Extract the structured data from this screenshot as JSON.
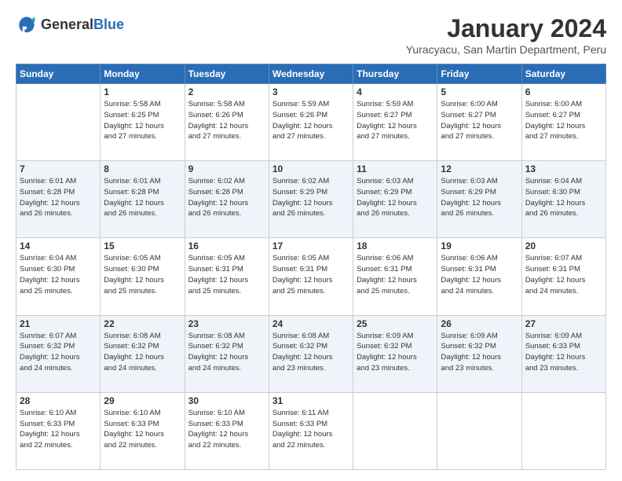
{
  "header": {
    "logo_general": "General",
    "logo_blue": "Blue",
    "title": "January 2024",
    "location": "Yuracyacu, San Martin Department, Peru"
  },
  "weekdays": [
    "Sunday",
    "Monday",
    "Tuesday",
    "Wednesday",
    "Thursday",
    "Friday",
    "Saturday"
  ],
  "weeks": [
    [
      {
        "day": "",
        "info": ""
      },
      {
        "day": "1",
        "info": "Sunrise: 5:58 AM\nSunset: 6:25 PM\nDaylight: 12 hours\nand 27 minutes."
      },
      {
        "day": "2",
        "info": "Sunrise: 5:58 AM\nSunset: 6:26 PM\nDaylight: 12 hours\nand 27 minutes."
      },
      {
        "day": "3",
        "info": "Sunrise: 5:59 AM\nSunset: 6:26 PM\nDaylight: 12 hours\nand 27 minutes."
      },
      {
        "day": "4",
        "info": "Sunrise: 5:59 AM\nSunset: 6:27 PM\nDaylight: 12 hours\nand 27 minutes."
      },
      {
        "day": "5",
        "info": "Sunrise: 6:00 AM\nSunset: 6:27 PM\nDaylight: 12 hours\nand 27 minutes."
      },
      {
        "day": "6",
        "info": "Sunrise: 6:00 AM\nSunset: 6:27 PM\nDaylight: 12 hours\nand 27 minutes."
      }
    ],
    [
      {
        "day": "7",
        "info": "Sunrise: 6:01 AM\nSunset: 6:28 PM\nDaylight: 12 hours\nand 26 minutes."
      },
      {
        "day": "8",
        "info": "Sunrise: 6:01 AM\nSunset: 6:28 PM\nDaylight: 12 hours\nand 26 minutes."
      },
      {
        "day": "9",
        "info": "Sunrise: 6:02 AM\nSunset: 6:28 PM\nDaylight: 12 hours\nand 26 minutes."
      },
      {
        "day": "10",
        "info": "Sunrise: 6:02 AM\nSunset: 6:29 PM\nDaylight: 12 hours\nand 26 minutes."
      },
      {
        "day": "11",
        "info": "Sunrise: 6:03 AM\nSunset: 6:29 PM\nDaylight: 12 hours\nand 26 minutes."
      },
      {
        "day": "12",
        "info": "Sunrise: 6:03 AM\nSunset: 6:29 PM\nDaylight: 12 hours\nand 26 minutes."
      },
      {
        "day": "13",
        "info": "Sunrise: 6:04 AM\nSunset: 6:30 PM\nDaylight: 12 hours\nand 26 minutes."
      }
    ],
    [
      {
        "day": "14",
        "info": "Sunrise: 6:04 AM\nSunset: 6:30 PM\nDaylight: 12 hours\nand 25 minutes."
      },
      {
        "day": "15",
        "info": "Sunrise: 6:05 AM\nSunset: 6:30 PM\nDaylight: 12 hours\nand 25 minutes."
      },
      {
        "day": "16",
        "info": "Sunrise: 6:05 AM\nSunset: 6:31 PM\nDaylight: 12 hours\nand 25 minutes."
      },
      {
        "day": "17",
        "info": "Sunrise: 6:05 AM\nSunset: 6:31 PM\nDaylight: 12 hours\nand 25 minutes."
      },
      {
        "day": "18",
        "info": "Sunrise: 6:06 AM\nSunset: 6:31 PM\nDaylight: 12 hours\nand 25 minutes."
      },
      {
        "day": "19",
        "info": "Sunrise: 6:06 AM\nSunset: 6:31 PM\nDaylight: 12 hours\nand 24 minutes."
      },
      {
        "day": "20",
        "info": "Sunrise: 6:07 AM\nSunset: 6:31 PM\nDaylight: 12 hours\nand 24 minutes."
      }
    ],
    [
      {
        "day": "21",
        "info": "Sunrise: 6:07 AM\nSunset: 6:32 PM\nDaylight: 12 hours\nand 24 minutes."
      },
      {
        "day": "22",
        "info": "Sunrise: 6:08 AM\nSunset: 6:32 PM\nDaylight: 12 hours\nand 24 minutes."
      },
      {
        "day": "23",
        "info": "Sunrise: 6:08 AM\nSunset: 6:32 PM\nDaylight: 12 hours\nand 24 minutes."
      },
      {
        "day": "24",
        "info": "Sunrise: 6:08 AM\nSunset: 6:32 PM\nDaylight: 12 hours\nand 23 minutes."
      },
      {
        "day": "25",
        "info": "Sunrise: 6:09 AM\nSunset: 6:32 PM\nDaylight: 12 hours\nand 23 minutes."
      },
      {
        "day": "26",
        "info": "Sunrise: 6:09 AM\nSunset: 6:32 PM\nDaylight: 12 hours\nand 23 minutes."
      },
      {
        "day": "27",
        "info": "Sunrise: 6:09 AM\nSunset: 6:33 PM\nDaylight: 12 hours\nand 23 minutes."
      }
    ],
    [
      {
        "day": "28",
        "info": "Sunrise: 6:10 AM\nSunset: 6:33 PM\nDaylight: 12 hours\nand 22 minutes."
      },
      {
        "day": "29",
        "info": "Sunrise: 6:10 AM\nSunset: 6:33 PM\nDaylight: 12 hours\nand 22 minutes."
      },
      {
        "day": "30",
        "info": "Sunrise: 6:10 AM\nSunset: 6:33 PM\nDaylight: 12 hours\nand 22 minutes."
      },
      {
        "day": "31",
        "info": "Sunrise: 6:11 AM\nSunset: 6:33 PM\nDaylight: 12 hours\nand 22 minutes."
      },
      {
        "day": "",
        "info": ""
      },
      {
        "day": "",
        "info": ""
      },
      {
        "day": "",
        "info": ""
      }
    ]
  ],
  "colors": {
    "header_bg": "#2a6db5",
    "shaded_row": "#f0f4fa"
  }
}
